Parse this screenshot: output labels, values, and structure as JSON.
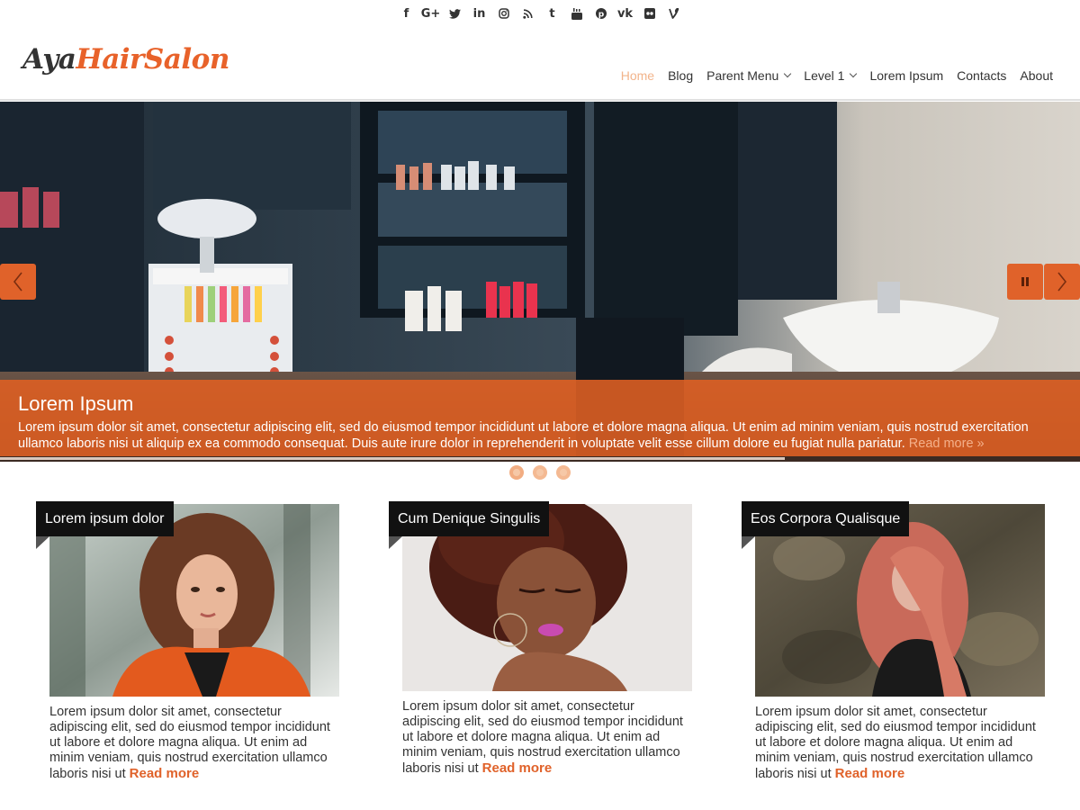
{
  "social": {
    "icons": [
      {
        "name": "facebook-icon",
        "glyph": "f"
      },
      {
        "name": "google-plus-icon",
        "glyph": "G+"
      },
      {
        "name": "twitter-icon",
        "glyph": "🐦"
      },
      {
        "name": "linkedin-icon",
        "glyph": "in"
      },
      {
        "name": "instagram-icon",
        "glyph": "◎"
      },
      {
        "name": "rss-icon",
        "glyph": "◔"
      },
      {
        "name": "tumblr-icon",
        "glyph": "t"
      },
      {
        "name": "youtube-icon",
        "glyph": "▶"
      },
      {
        "name": "pinterest-icon",
        "glyph": "P"
      },
      {
        "name": "vk-icon",
        "glyph": "vk"
      },
      {
        "name": "flickr-icon",
        "glyph": "●●"
      },
      {
        "name": "vine-icon",
        "glyph": "V"
      }
    ]
  },
  "logo": {
    "part1": "Aya",
    "part2": "HairSalon"
  },
  "nav": {
    "items": [
      {
        "label": "Home",
        "active": true,
        "dropdown": false
      },
      {
        "label": "Blog",
        "active": false,
        "dropdown": false
      },
      {
        "label": "Parent Menu",
        "active": false,
        "dropdown": true
      },
      {
        "label": "Level 1",
        "active": false,
        "dropdown": true
      },
      {
        "label": "Lorem Ipsum",
        "active": false,
        "dropdown": false
      },
      {
        "label": "Contacts",
        "active": false,
        "dropdown": false
      },
      {
        "label": "About",
        "active": false,
        "dropdown": false
      }
    ]
  },
  "slider": {
    "title": "Lorem Ipsum",
    "text": "Lorem ipsum dolor sit amet, consectetur adipiscing elit, sed do eiusmod tempor incididunt ut labore et dolore magna aliqua. Ut enim ad minim veniam, quis nostrud exercitation ullamco laboris nisi ut aliquip ex ea commodo consequat. Duis aute irure dolor in reprehenderit in voluptate velit esse cillum dolore eu fugiat nulla pariatur.",
    "read_more": "Read more »",
    "progress": 0.727,
    "slide_count": 3,
    "active_slide": 0
  },
  "colors": {
    "accent": "#e0622a",
    "logo_dark": "#333333",
    "nav_active": "#f2b48b"
  },
  "cards": [
    {
      "title": "Lorem ipsum dolor",
      "text": "Lorem ipsum dolor sit amet, consectetur adipiscing elit, sed do eiusmod tempor incididunt ut labore et dolore magna aliqua. Ut enim ad minim veniam, quis nostrud exercitation ullamco laboris nisi ut",
      "read_more": "Read more"
    },
    {
      "title": "Cum Denique Singulis",
      "text": "Lorem ipsum dolor sit amet, consectetur adipiscing elit, sed do eiusmod tempor incididunt ut labore et dolore magna aliqua. Ut enim ad minim veniam, quis nostrud exercitation ullamco laboris nisi ut",
      "read_more": "Read more"
    },
    {
      "title": "Eos Corpora Qualisque",
      "text": "Lorem ipsum dolor sit amet, consectetur adipiscing elit, sed do eiusmod tempor incididunt ut labore et dolore magna aliqua. Ut enim ad minim veniam, quis nostrud exercitation ullamco laboris nisi ut",
      "read_more": "Read more"
    }
  ]
}
